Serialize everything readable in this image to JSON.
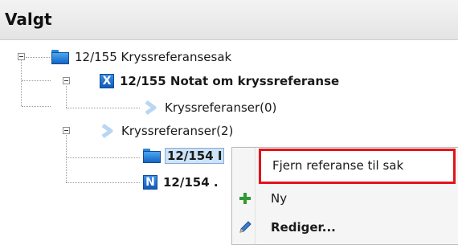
{
  "panel": {
    "title": "Valgt"
  },
  "tree": {
    "root": {
      "label": "12/155 Kryssreferansesak",
      "icon": "folder-icon"
    },
    "child1": {
      "label": "12/155 Notat om kryssreferanse",
      "icon": "x-document-icon",
      "icon_letter": "X"
    },
    "child1_sub": {
      "label": "Kryssreferanser(0)",
      "icon": "chevron-right-icon"
    },
    "child2": {
      "label": "Kryssreferanser(2)",
      "icon": "chevron-right-icon"
    },
    "ref1": {
      "label": "12/154 I",
      "icon": "folder-icon",
      "selected": true
    },
    "ref2": {
      "label": "12/154 .",
      "icon": "n-document-icon",
      "icon_letter": "N"
    }
  },
  "context_menu": {
    "items": [
      {
        "label": "Fjern referanse til sak",
        "icon": "",
        "highlighted": true
      },
      {
        "label": "Ny",
        "icon": "plus-icon"
      },
      {
        "label": "Rediger...",
        "icon": "pencil-icon"
      }
    ]
  },
  "colors": {
    "highlight_border": "#e3131b",
    "selection": "#cde3f7",
    "icon_blue": "#1e78d4",
    "plus_green": "#2f9a2f"
  }
}
